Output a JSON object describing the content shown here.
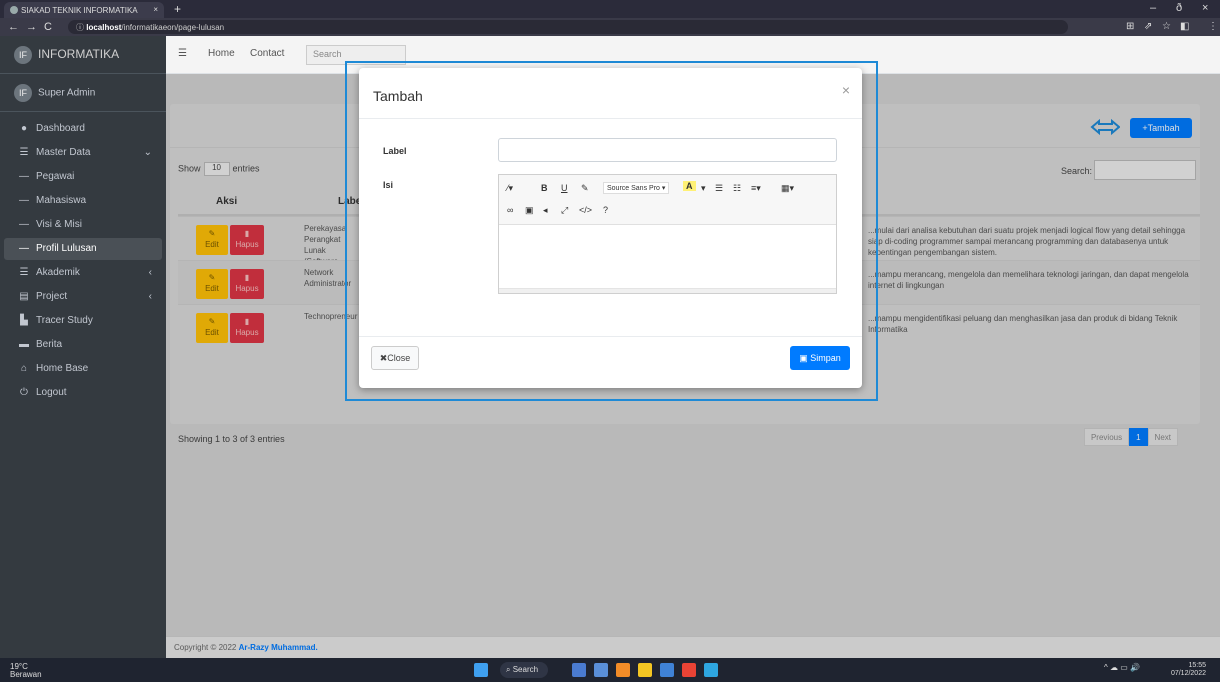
{
  "browser": {
    "tab_title": "SIAKAD TEKNIK INFORMATIKA",
    "tab_close": "×",
    "new_tab": "+",
    "url_host": "localhost",
    "url_path": "/informatikaeon/page-lulusan",
    "nav_back": "←",
    "nav_forward": "→",
    "nav_reload": "C",
    "win_min": "–",
    "win_max": "ð",
    "win_close": "×"
  },
  "sidebar": {
    "brand": "INFORMATIKA",
    "brand_logo": "IF",
    "user": "Super Admin",
    "user_logo": "IF",
    "items": [
      {
        "label": "Dashboard",
        "icon": "dashboard-icon",
        "glyph": "●"
      },
      {
        "label": "Master Data",
        "icon": "list-icon",
        "glyph": "☰",
        "arrow": "⌄"
      },
      {
        "label": "Pegawai",
        "icon": "dash-icon",
        "glyph": "—"
      },
      {
        "label": "Mahasiswa",
        "icon": "dash-icon",
        "glyph": "—"
      },
      {
        "label": "Visi & Misi",
        "icon": "dash-icon",
        "glyph": "—"
      },
      {
        "label": "Profil Lulusan",
        "icon": "dash-icon",
        "glyph": "—"
      },
      {
        "label": "Akademik",
        "icon": "list-icon",
        "glyph": "☰",
        "arrow": "‹"
      },
      {
        "label": "Project",
        "icon": "server-icon",
        "glyph": "▤",
        "arrow": "‹"
      },
      {
        "label": "Tracer Study",
        "icon": "chart-icon",
        "glyph": "▙"
      },
      {
        "label": "Berita",
        "icon": "news-icon",
        "glyph": "▬"
      },
      {
        "label": "Home Base",
        "icon": "home-icon",
        "glyph": "⌂"
      },
      {
        "label": "Logout",
        "icon": "logout-icon",
        "glyph": "⏻"
      }
    ]
  },
  "topnav": {
    "menu_icon": "☰",
    "home": "Home",
    "contact": "Contact",
    "search": "Search"
  },
  "page": {
    "tambah_label": "+Tambah",
    "show": "Show",
    "entries_value": "10",
    "entries": "entries",
    "search_label": "Search:",
    "col_aksi": "Aksi",
    "col_label": "Label",
    "rows": [
      {
        "label": "Perekayasa Perangkat Lunak (Software Engineer)",
        "desc": "...mulai dari analisa kebutuhan dari suatu projek menjadi logical flow yang detail sehingga siap di-coding programmer sampai merancang programming dan databasenya untuk kepentingan pengembangan sistem."
      },
      {
        "label": "Network Administrator",
        "desc": "...mampu merancang, mengelola dan memelihara teknologi jaringan, dan dapat mengelola internet di lingkungan"
      },
      {
        "label": "Technopreneur",
        "desc": "...mampu mengidentifikasi peluang dan menghasilkan jasa dan produk di bidang Teknik Informatika"
      }
    ],
    "edit": "Edit",
    "hapus": "Hapus",
    "showing": "Showing 1 to 3 of 3 entries",
    "prev": "Previous",
    "page_num": "1",
    "next": "Next"
  },
  "footer": {
    "text": "Copyright © 2022",
    "author": "Ar-Razy Muhammad."
  },
  "modal": {
    "title": "Tambah",
    "close_x": "×",
    "label": "Label",
    "isi": "Isi",
    "font_name": "Source Sans Pro",
    "close_btn": "✖Close",
    "save_btn": "Simpan"
  },
  "taskbar": {
    "temp": "19°C",
    "weather": "Berawan",
    "search": "Search",
    "time": "15:55",
    "date": "07/12/2022"
  }
}
